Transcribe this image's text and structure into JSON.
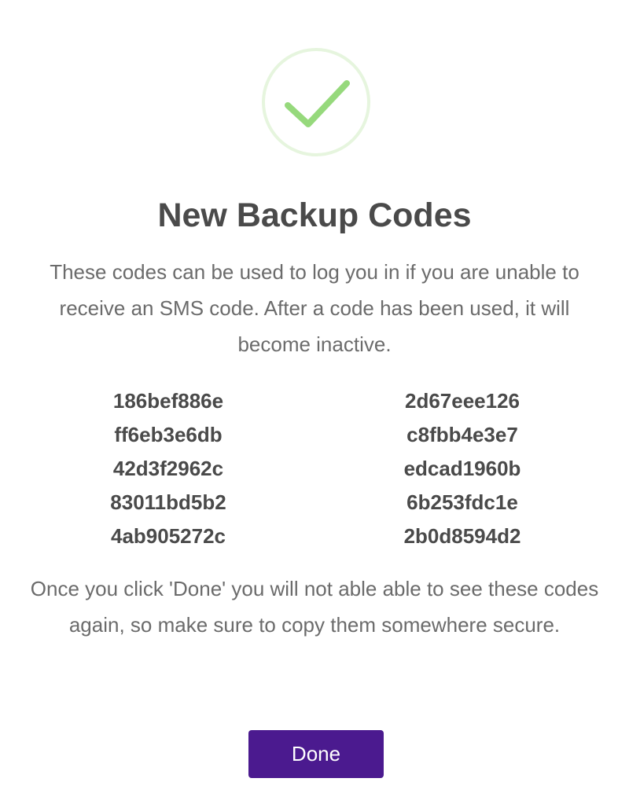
{
  "icon": {
    "name": "checkmark-icon",
    "color": "#96d97c",
    "ring_color": "#e6f5de"
  },
  "title": "New Backup Codes",
  "description": "These codes can be used to log you in if you are unable to receive an SMS code. After a code has been used, it will become inactive.",
  "codes": {
    "left": [
      "186bef886e",
      "ff6eb3e6db",
      "42d3f2962c",
      "83011bd5b2",
      "4ab905272c"
    ],
    "right": [
      "2d67eee126",
      "c8fbb4e3e7",
      "edcad1960b",
      "6b253fdc1e",
      "2b0d8594d2"
    ]
  },
  "notice": "Once you click 'Done' you will not able able to see these codes again, so make sure to copy them somewhere secure.",
  "done_button": {
    "label": "Done",
    "color": "#4b1a8f"
  }
}
